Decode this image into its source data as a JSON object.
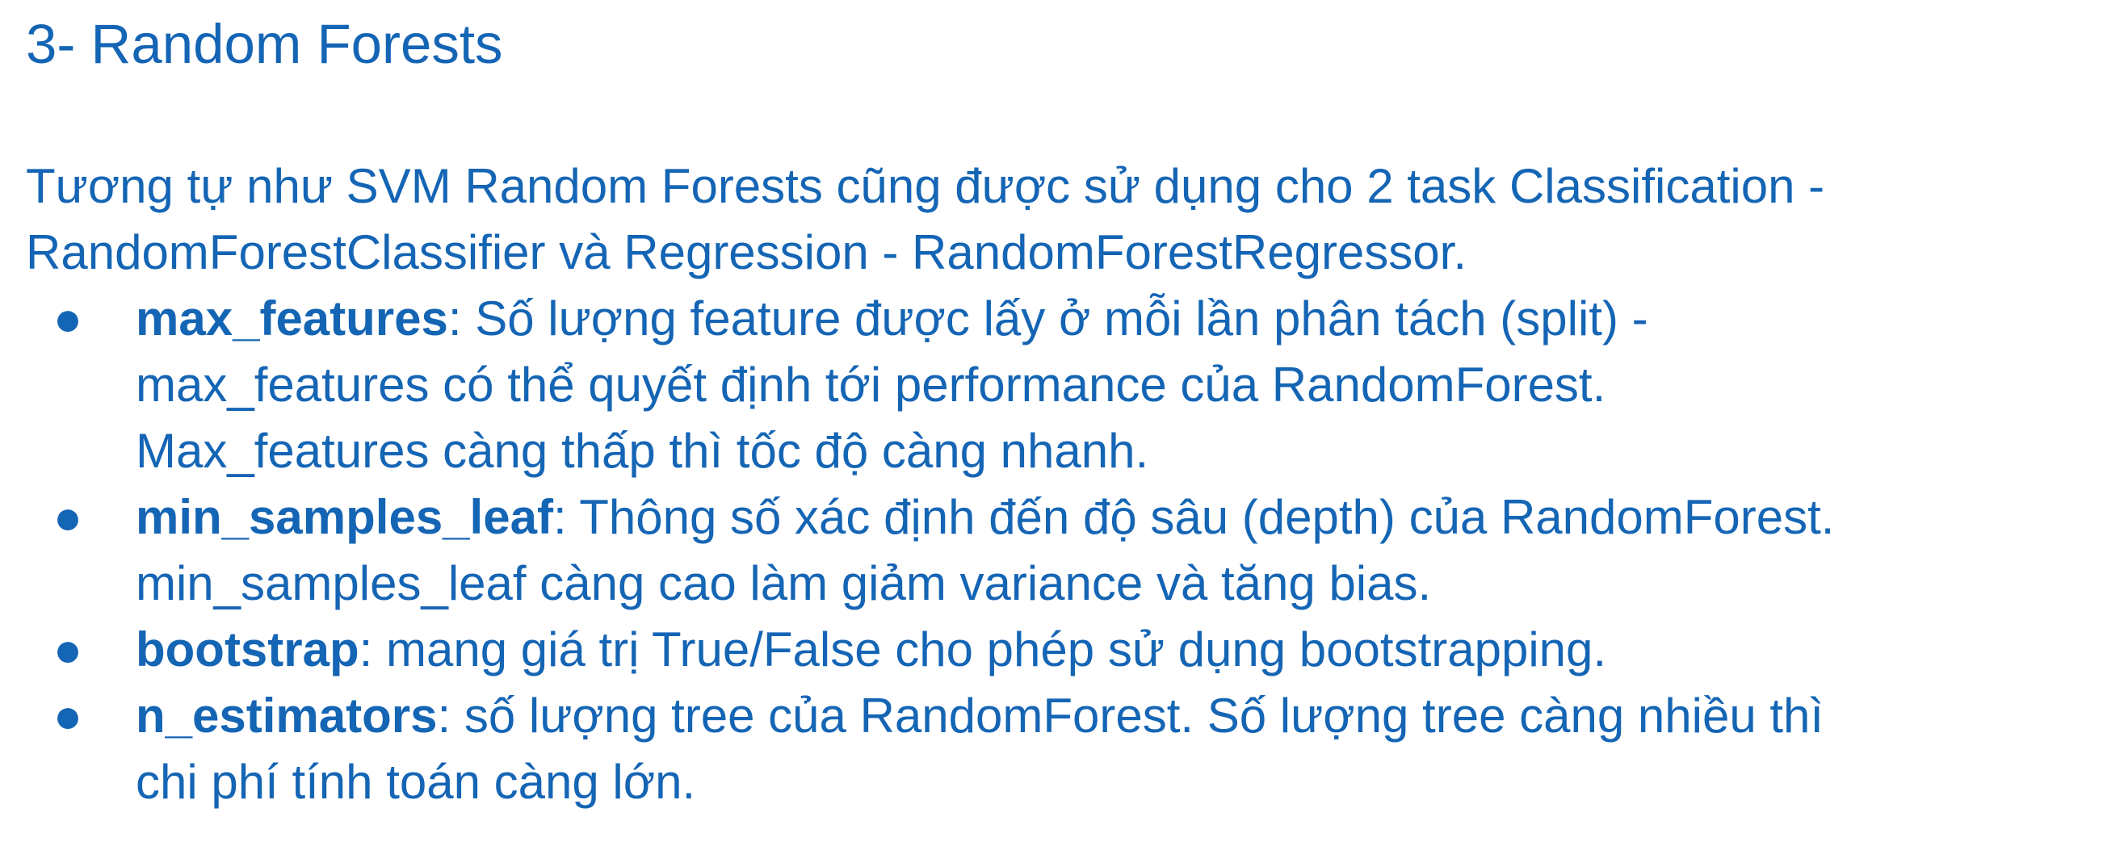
{
  "title": "3- Random Forests",
  "intro": {
    "line1": "Tương tự như SVM Random Forests cũng được sử dụng cho 2 task Classification -",
    "line2": "RandomForestClassifier và Regression - RandomForestRegressor."
  },
  "bullet_char": "●",
  "items": [
    {
      "term": "max_features",
      "first": ": Số lượng feature được lấy ở mỗi lần phân tách (split) -",
      "lines": [
        "max_features có thể quyết định tới performance của RandomForest.",
        "Max_features càng thấp thì tốc độ càng nhanh."
      ]
    },
    {
      "term": "min_samples_leaf",
      "first": ": Thông số xác định đến độ sâu (depth) của RandomForest.",
      "lines": [
        "min_samples_leaf càng cao làm giảm variance và tăng bias."
      ]
    },
    {
      "term": "bootstrap",
      "first": ": mang giá trị True/False cho phép sử dụng bootstrapping.",
      "lines": []
    },
    {
      "term": "n_estimators",
      "first": ": số lượng tree của RandomForest. Số lượng tree càng nhiều thì",
      "lines": [
        "chi phí tính toán càng lớn."
      ]
    }
  ]
}
